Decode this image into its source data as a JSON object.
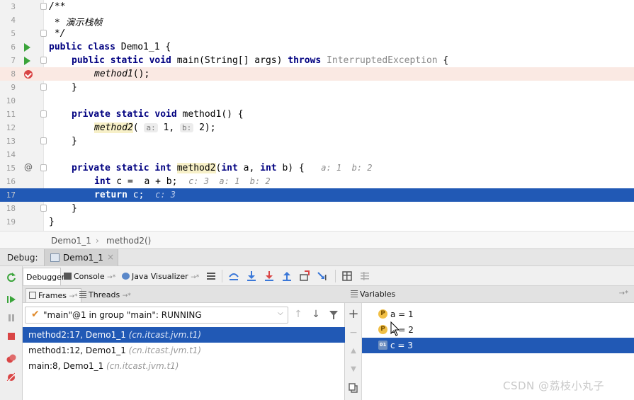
{
  "editor": {
    "lines": [
      {
        "n": "3"
      },
      {
        "n": "4"
      },
      {
        "n": "5"
      },
      {
        "n": "6"
      },
      {
        "n": "7"
      },
      {
        "n": "8"
      },
      {
        "n": "9"
      },
      {
        "n": "10"
      },
      {
        "n": "11"
      },
      {
        "n": "12"
      },
      {
        "n": "13"
      },
      {
        "n": "14"
      },
      {
        "n": "15"
      },
      {
        "n": "16"
      },
      {
        "n": "17"
      },
      {
        "n": "18"
      },
      {
        "n": "19"
      }
    ],
    "c3": "/**",
    "c4": " * 演示栈帧",
    "c5": " */",
    "l6_kw": "public class",
    "l6_name": " Demo1_1 {",
    "l7_kw1": "public static void",
    "l7_sig": " main(String[] args) ",
    "l7_kw2": "throws",
    "l7_exc": " InterruptedException",
    "l7_end": " {",
    "l8_call": "method1",
    "l8_end": "();",
    "l9": "}",
    "l11_kw": "private static void",
    "l11_sig": " method1() {",
    "l12_call": "method2",
    "l12_open": "( ",
    "l12_hint_a": "a:",
    "l12_v1": " 1, ",
    "l12_hint_b": "b:",
    "l12_v2": " 2);",
    "l13": "}",
    "l15_kw": "private static int",
    "l15_sp": " ",
    "l15_name": "method2",
    "l15_open": "(",
    "l15_int1": "int",
    "l15_p1": " a",
    "l15_comma": ", ",
    "l15_int2": "int",
    "l15_p2": " b",
    "l15_end": ") {",
    "l15_inline": "a: 1  b: 2",
    "l16_kw": "int",
    "l16_code": " c =  a + b;",
    "l16_inline": "c: 3  a: 1  b: 2",
    "l17_kw": "return",
    "l17_code": " c;",
    "l17_inline": "c: 3",
    "l18": "}",
    "l19": "}"
  },
  "breadcrumbs": {
    "class": "Demo1_1",
    "sep": "›",
    "method": "method2()"
  },
  "debug": {
    "label": "Debug:",
    "tab": "Demo1_1",
    "tab_close": "×"
  },
  "toolbar": {
    "debugger": "Debugger",
    "console": "Console",
    "visualizer": "Java Visualizer",
    "pin": "→*"
  },
  "frames": {
    "tab_frames": "Frames",
    "tab_threads": "Threads",
    "pin": "→*",
    "thread": "\"main\"@1 in group \"main\": RUNNING",
    "rows": [
      {
        "name": "method2:17, Demo1_1",
        "pkg": "(cn.itcast.jvm.t1)"
      },
      {
        "name": "method1:12, Demo1_1",
        "pkg": "(cn.itcast.jvm.t1)"
      },
      {
        "name": "main:8, Demo1_1",
        "pkg": "(cn.itcast.jvm.t1)"
      }
    ]
  },
  "variables": {
    "title": "Variables",
    "pin": "→*",
    "rows": [
      {
        "icon": "P",
        "text": "a = 1"
      },
      {
        "icon": "P",
        "text": "b = 2"
      },
      {
        "icon": "01",
        "text": "c = 3"
      }
    ]
  },
  "watermark": "CSDN @荔枝小丸子",
  "colors": {
    "selection": "#2159b5",
    "breakpoint": "#d94545",
    "run": "#3aa43a",
    "keyword": "#000080"
  }
}
